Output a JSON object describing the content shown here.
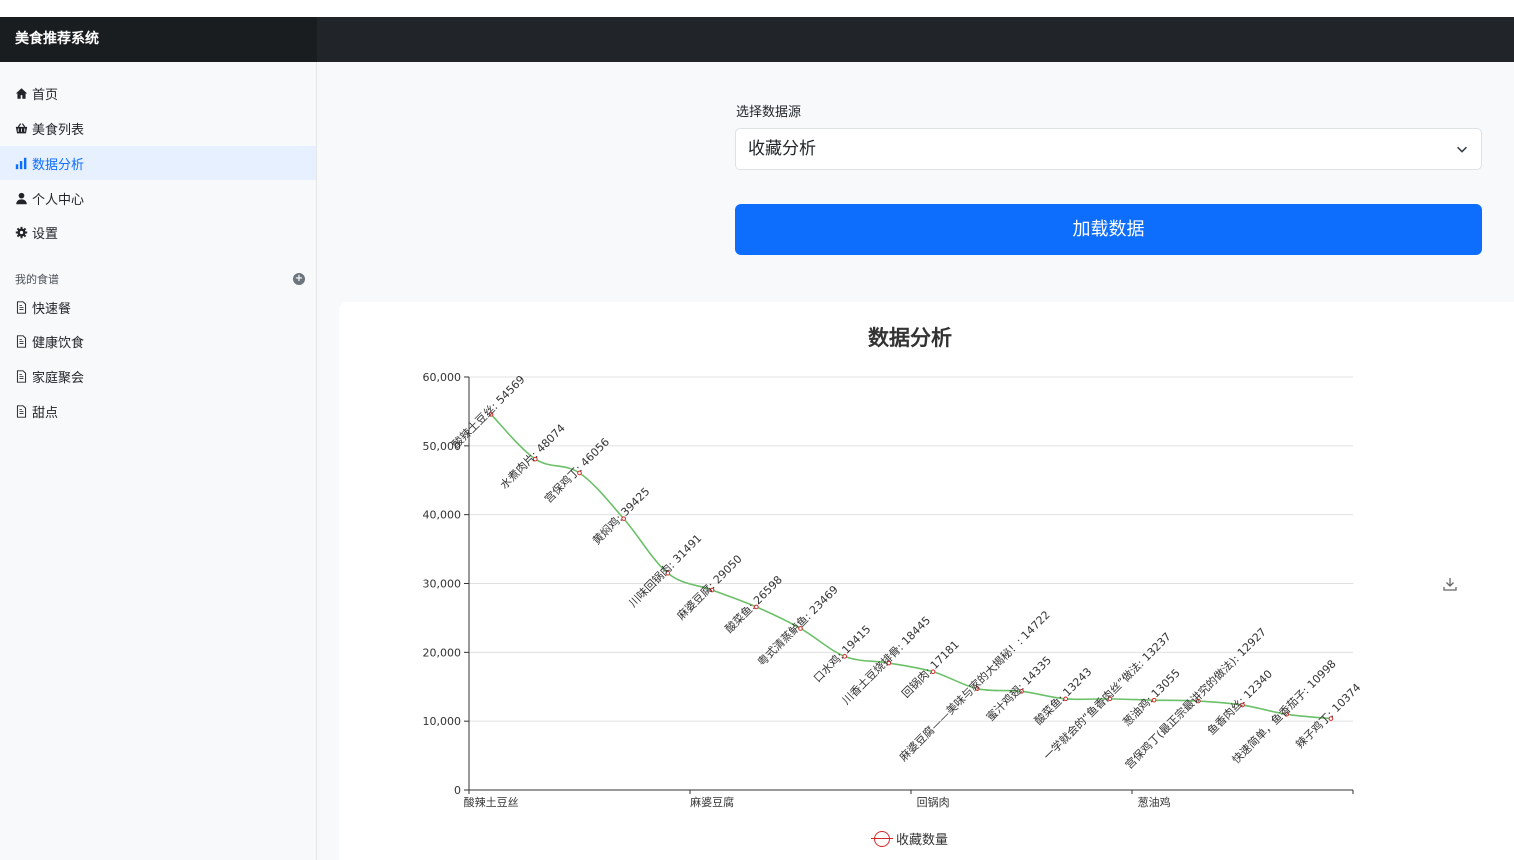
{
  "app": {
    "title": "美食推荐系统"
  },
  "sidebar": {
    "nav": [
      {
        "label": "首页",
        "icon": "home-icon"
      },
      {
        "label": "美食列表",
        "icon": "basket-icon"
      },
      {
        "label": "数据分析",
        "icon": "bar-chart-icon",
        "active": true
      },
      {
        "label": "个人中心",
        "icon": "person-icon"
      },
      {
        "label": "设置",
        "icon": "gear-icon"
      }
    ],
    "section_title": "我的食谱",
    "recipes": [
      {
        "label": "快速餐",
        "icon": "document-icon"
      },
      {
        "label": "健康饮食",
        "icon": "document-icon"
      },
      {
        "label": "家庭聚会",
        "icon": "document-icon"
      },
      {
        "label": "甜点",
        "icon": "document-icon"
      }
    ]
  },
  "form": {
    "source_label": "选择数据源",
    "source_selected": "收藏分析",
    "load_button": "加载数据"
  },
  "colors": {
    "accent": "#0d6efd",
    "line": "#6cc06a",
    "marker": "#d62728",
    "navbar": "#212529"
  },
  "chart_data": {
    "type": "line",
    "title": "数据分析",
    "legend": [
      "收藏数量"
    ],
    "legend_position": "bottom",
    "ylim": [
      0,
      60000
    ],
    "yticks": [
      "0",
      "10,000",
      "20,000",
      "30,000",
      "40,000",
      "50,000",
      "60,000"
    ],
    "xticks": [
      "酸辣土豆丝",
      "麻婆豆腐",
      "回锅肉",
      "葱油鸡"
    ],
    "grid": true,
    "smooth": true,
    "series": [
      {
        "name": "收藏数量",
        "points": [
          {
            "label": "酸辣土豆丝: 54569",
            "value": 54569
          },
          {
            "label": "水煮肉片: 48074",
            "value": 48074
          },
          {
            "label": "宫保鸡丁: 46056",
            "value": 46056
          },
          {
            "label": "黄焖鸡: 39425",
            "value": 39425
          },
          {
            "label": "川味回锅肉: 31491",
            "value": 31491
          },
          {
            "label": "麻婆豆腐: 29050",
            "value": 29050
          },
          {
            "label": "酸菜鱼: 26598",
            "value": 26598
          },
          {
            "label": "粤式清蒸鲈鱼: 23469",
            "value": 23469
          },
          {
            "label": "口水鸡: 19415",
            "value": 19415
          },
          {
            "label": "川香土豆烧排骨: 18445",
            "value": 18445
          },
          {
            "label": "回锅肉: 17181",
            "value": 17181
          },
          {
            "label": "麻婆豆腐——美味与家的大揭秘！: 14722",
            "value": 14722
          },
          {
            "label": "蜜汁鸡翅: 14335",
            "value": 14335
          },
          {
            "label": "酸菜鱼: 13243",
            "value": 13243
          },
          {
            "label": "一学就会的“鱼香肉丝”做法: 13237",
            "value": 13237
          },
          {
            "label": "葱油鸡: 13055",
            "value": 13055
          },
          {
            "label": "宫保鸡丁(最正宗最讲究的做法): 12927",
            "value": 12927
          },
          {
            "label": "鱼香肉丝: 12340",
            "value": 12340
          },
          {
            "label": "快速简单，鱼香茄子: 10998",
            "value": 10998
          },
          {
            "label": "辣子鸡丁: 10374",
            "value": 10374
          }
        ]
      }
    ]
  }
}
